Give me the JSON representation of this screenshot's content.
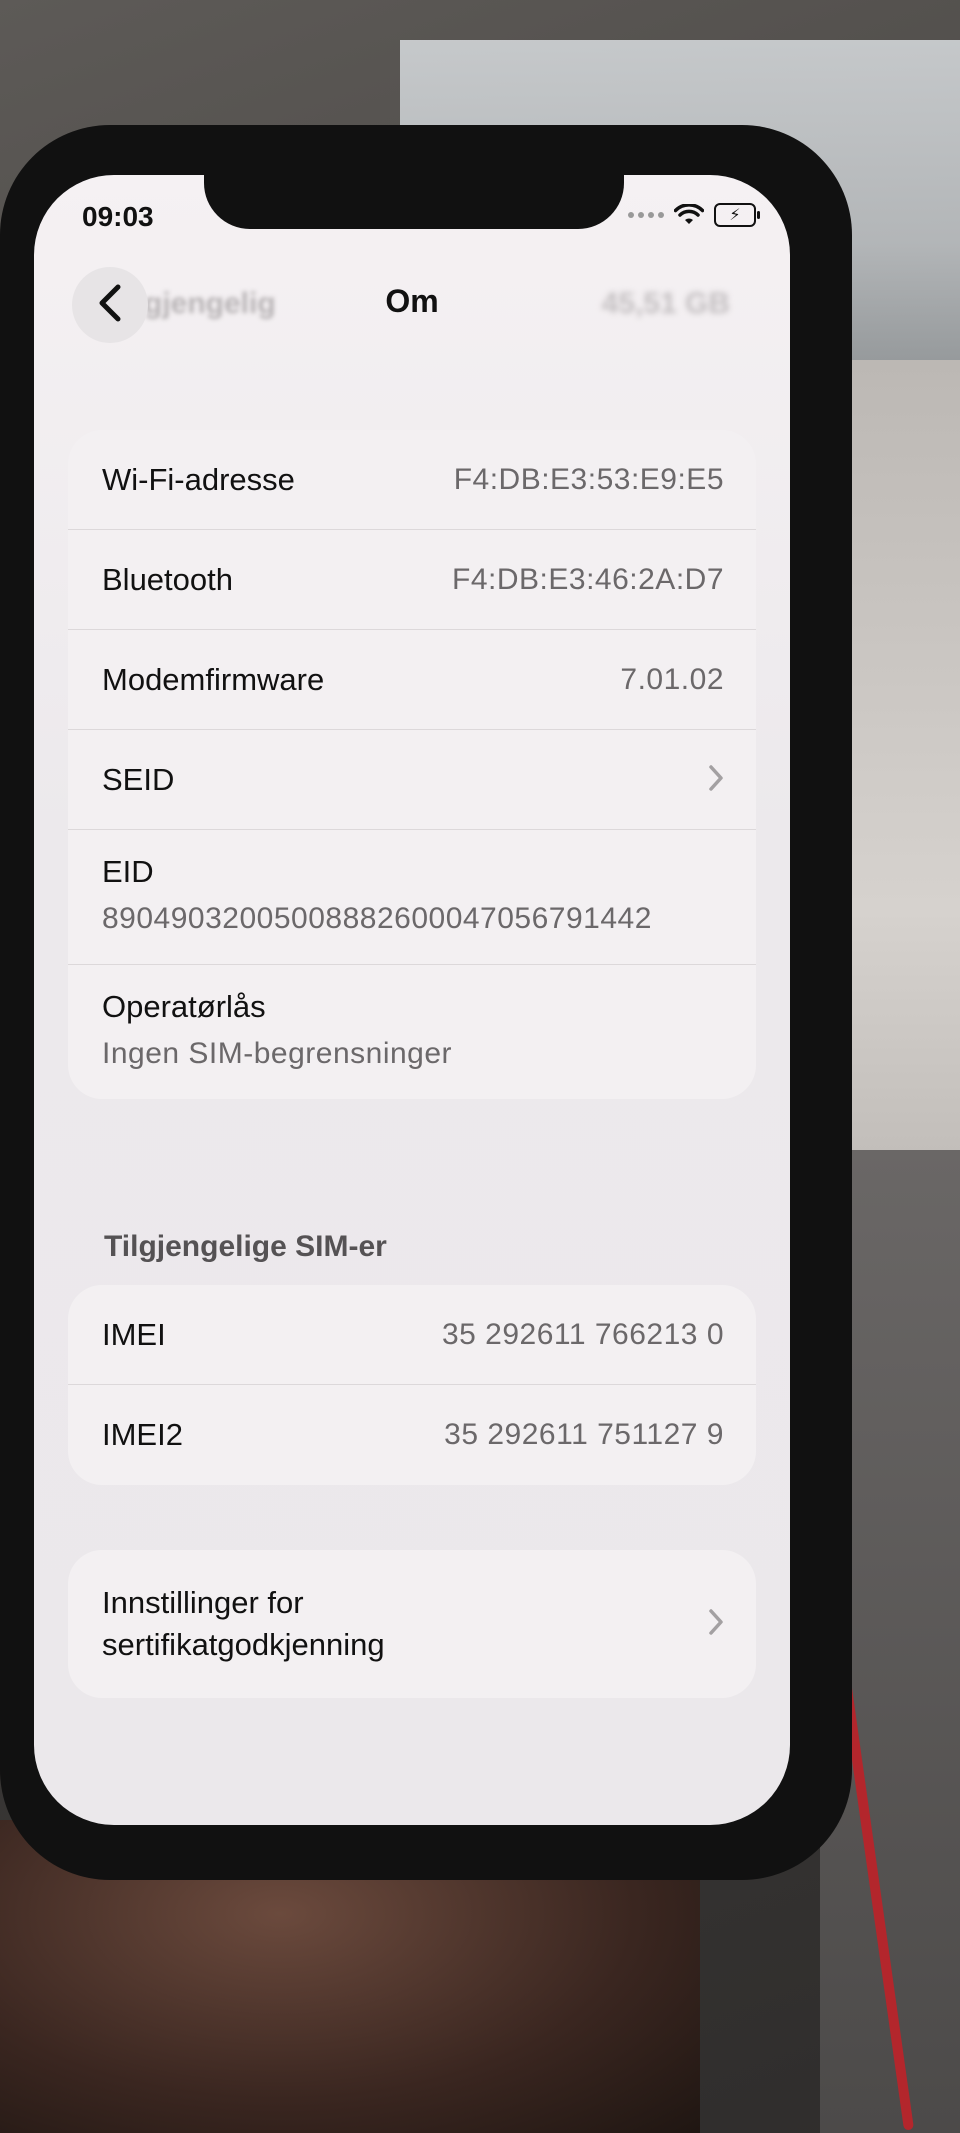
{
  "status_bar": {
    "time": "09:03",
    "battery_icon": "battery-charging-icon",
    "wifi_icon": "wifi-icon"
  },
  "nav": {
    "back_icon": "chevron-left-icon",
    "title": "Om",
    "ghost_left": "gjengelig",
    "ghost_right": "45,51 GB"
  },
  "info_rows": [
    {
      "label": "Wi-Fi-adresse",
      "value": "F4:DB:E3:53:E9:E5"
    },
    {
      "label": "Bluetooth",
      "value": "F4:DB:E3:46:2A:D7"
    },
    {
      "label": "Modemfirmware",
      "value": "7.01.02"
    },
    {
      "label": "SEID",
      "value": ""
    },
    {
      "label": "EID",
      "value": "89049032005008882600047056791442"
    },
    {
      "label": "Operatørlås",
      "value": "Ingen SIM-begrensninger"
    }
  ],
  "sim_section": {
    "header": "Tilgjengelige SIM-er",
    "rows": [
      {
        "label": "IMEI",
        "value": "35 292611 766213 0"
      },
      {
        "label": "IMEI2",
        "value": "35 292611 751127 9"
      }
    ]
  },
  "cert_row": {
    "label_line1": "Innstillinger for",
    "label_line2": "sertifikatgodkjenning"
  }
}
